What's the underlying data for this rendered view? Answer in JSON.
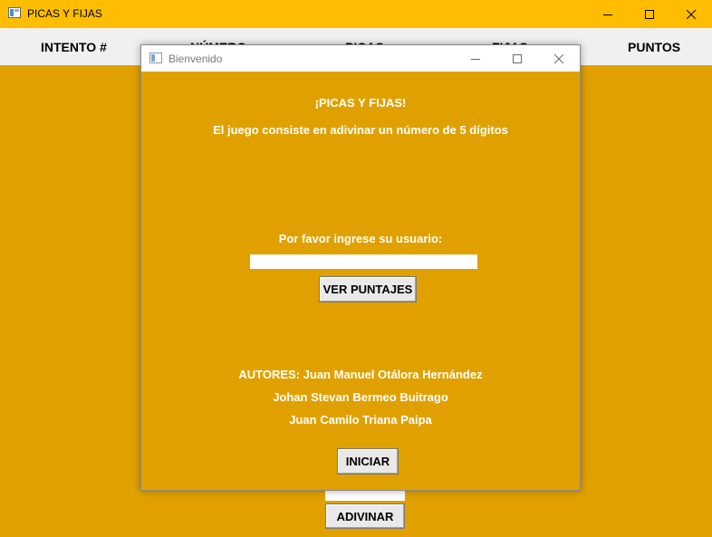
{
  "main_window": {
    "title": "PICAS Y FIJAS",
    "columns": [
      "INTENTO #",
      "NÚMERO",
      "PICAS",
      "FIJAS",
      "PUNTOS"
    ],
    "guess_button": "ADIVINAR"
  },
  "dialog": {
    "title": "Bienvenido",
    "heading": "¡PICAS Y FIJAS!",
    "description": "El juego consiste en adivinar un número de 5 dígitos",
    "user_prompt": "Por favor ingrese su usuario:",
    "user_value": "",
    "scores_button": "VER PUNTAJES",
    "authors": [
      "AUTORES: Juan Manuel Otálora Hernández",
      "Johan Stevan Bermeo Buitrago",
      "Juan Camilo Triana Paipa"
    ],
    "start_button": "INICIAR"
  },
  "colors": {
    "background": "#e0a100",
    "main_titlebar": "#ffbd00",
    "header_row": "#f0f0f0"
  }
}
